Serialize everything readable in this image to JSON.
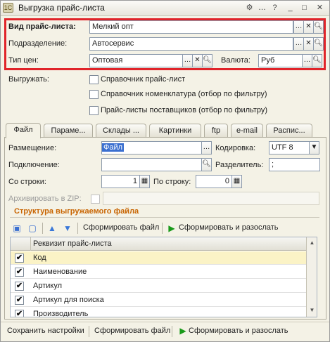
{
  "window": {
    "title": "Выгрузка прайс-листа",
    "icon": "1c-form-icon"
  },
  "titlebar_buttons": [
    "⚙",
    "…",
    "?",
    "_",
    "□",
    "✕"
  ],
  "fields": {
    "price_list_type": {
      "label": "Вид прайс-листа:",
      "value": "Мелкий опт"
    },
    "department": {
      "label": "Подразделение:",
      "value": "Автосервис"
    },
    "price_type": {
      "label": "Тип цен:",
      "value": "Оптовая"
    },
    "currency": {
      "label": "Валюта:",
      "value": "Руб"
    }
  },
  "export": {
    "label": "Выгружать:",
    "options": [
      {
        "label": "Справочник прайс-лист",
        "checked": false
      },
      {
        "label": "Справочник номенклатура (отбор по фильтру)",
        "checked": false
      },
      {
        "label": "Прайс-листы поставщиков (отбор по фильтру)",
        "checked": false
      }
    ]
  },
  "tabs": [
    "Файл",
    "Параме...",
    "Склады ...",
    "Картинки",
    "ftp",
    "e-mail",
    "Распис..."
  ],
  "file_tab": {
    "placement_label": "Размещение:",
    "placement_value": "Файл",
    "encoding_label": "Кодировка:",
    "encoding_value": "UTF 8",
    "connection_label": "Подключение:",
    "connection_value": "",
    "separator_label": "Разделитель:",
    "separator_value": ";",
    "from_row_label": "Со строки:",
    "from_row_value": "1",
    "to_row_label": "По строку:",
    "to_row_value": "0",
    "zip_label": "Архивировать в ZIP:",
    "structure_title": "Структура выгружаемого файла"
  },
  "toolbar": {
    "form_file": "Сформировать файл",
    "form_and_send": "Сформировать и разослать"
  },
  "grid": {
    "column": "Реквизит прайс-листа",
    "rows": [
      {
        "label": "Код",
        "checked": true
      },
      {
        "label": "Наименование",
        "checked": true
      },
      {
        "label": "Артикул",
        "checked": true
      },
      {
        "label": "Артикул для поиска",
        "checked": true
      },
      {
        "label": "Производитель",
        "checked": true
      }
    ]
  },
  "bottom": {
    "save_settings": "Сохранить настройки",
    "form_file": "Сформировать файл",
    "form_and_send": "Сформировать и разослать"
  },
  "colors": {
    "highlight_frame": "#e0242a",
    "section_title": "#c86400",
    "accent_green": "#1a9a1a"
  }
}
